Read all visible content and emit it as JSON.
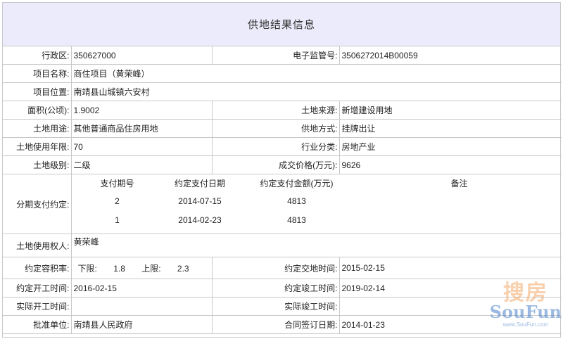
{
  "title": "供地结果信息",
  "rows": {
    "district_label": "行政区:",
    "district_value": "350627000",
    "supervision_label": "电子监管号:",
    "supervision_value": "3506272014B00059",
    "project_name_label": "项目名称:",
    "project_name_value": "商住项目（黄荣峰）",
    "location_label": "项目位置:",
    "location_value": "南靖县山城镇六安村",
    "area_label": "面积(公顷):",
    "area_value": "1.9002",
    "source_label": "土地来源:",
    "source_value": "新增建设用地",
    "usage_label": "土地用途:",
    "usage_value": "其他普通商品住房用地",
    "supply_label": "供地方式:",
    "supply_value": "挂牌出让",
    "term_label": "土地使用年限:",
    "term_value": "70",
    "industry_label": "行业分类:",
    "industry_value": "房地产业",
    "grade_label": "土地级别:",
    "grade_value": "二级",
    "price_label": "成交价格(万元):",
    "price_value": "9626",
    "installment_label": "分期支付约定:",
    "owner_label": "土地使用权人:",
    "owner_value": "黄荣峰",
    "far_label": "约定容积率:",
    "far_lower_label": "下限:",
    "far_lower_value": "1.8",
    "far_upper_label": "上限:",
    "far_upper_value": "2.3",
    "delivery_label": "约定交地时间:",
    "delivery_value": "2015-02-15",
    "start_label": "约定开工时间:",
    "start_value": "2016-02-15",
    "complete_label": "约定竣工时间:",
    "complete_value": "2019-02-14",
    "actual_start_label": "实际开工时间:",
    "actual_start_value": "",
    "actual_complete_label": "实际竣工时间:",
    "actual_complete_value": "",
    "approver_label": "批准单位:",
    "approver_value": "南靖县人民政府",
    "contract_label": "合同签订日期:",
    "contract_value": "2014-01-23"
  },
  "payments": {
    "headers": [
      "支付期号",
      "约定支付日期",
      "约定支付金额(万元)",
      "备注"
    ],
    "rows": [
      {
        "period": "2",
        "date": "2014-07-15",
        "amount": "4813",
        "note": ""
      },
      {
        "period": "1",
        "date": "2014-02-23",
        "amount": "4813",
        "note": ""
      }
    ]
  },
  "watermark": {
    "cn": "搜房",
    "en": "SouFun",
    "url": "www.SouFun.com"
  }
}
